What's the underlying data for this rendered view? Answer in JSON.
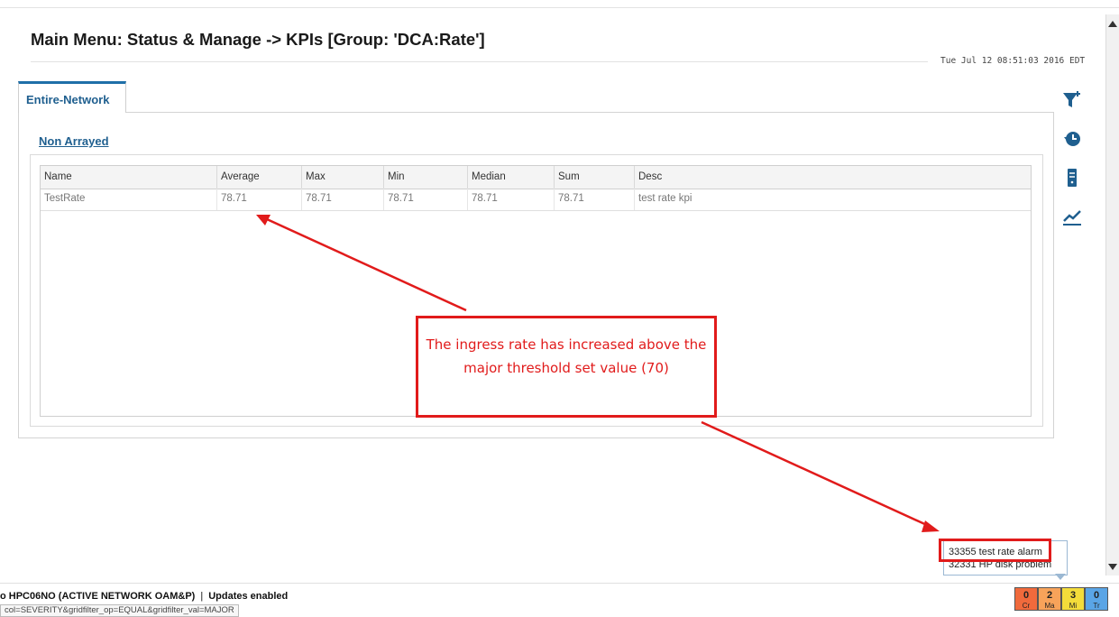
{
  "header": {
    "title": "Main Menu: Status & Manage -> KPIs [Group: 'DCA:Rate']",
    "timestamp": "Tue Jul 12 08:51:03 2016 EDT"
  },
  "tabs": [
    {
      "label": "Entire-Network",
      "active": true
    }
  ],
  "section_label": "Non Arrayed",
  "table": {
    "columns": [
      "Name",
      "Average",
      "Max",
      "Min",
      "Median",
      "Sum",
      "Desc"
    ],
    "rows": [
      [
        "TestRate",
        "78.71",
        "78.71",
        "78.71",
        "78.71",
        "78.71",
        "test rate kpi"
      ]
    ]
  },
  "toolbar_icons": [
    "filter-add-icon",
    "history-icon",
    "server-icon",
    "trend-chart-icon"
  ],
  "annotation": {
    "text": "The ingress rate has increased above the major threshold set value (70)",
    "color": "#e11b1b"
  },
  "alarm_popup": {
    "items": [
      "33355 test rate alarm",
      "32331 HP disk problem"
    ]
  },
  "status_bar": {
    "server_text": "o HPC06NO (ACTIVE NETWORK OAM&P)",
    "separator": "|",
    "updates": "Updates enabled",
    "url_hint": "col=SEVERITY&gridfilter_op=EQUAL&gridfilter_val=MAJOR"
  },
  "alarm_counters": [
    {
      "count": "0",
      "label": "Cr",
      "color": "#f06a3c"
    },
    {
      "count": "2",
      "label": "Ma",
      "color": "#f7a35a"
    },
    {
      "count": "3",
      "label": "Mi",
      "color": "#f4dc3a"
    },
    {
      "count": "0",
      "label": "Tr",
      "color": "#5aa5e6"
    }
  ],
  "colors": {
    "accent": "#1f5f8f",
    "tab_border": "#1f6fa8",
    "annotation_red": "#e11b1b"
  }
}
